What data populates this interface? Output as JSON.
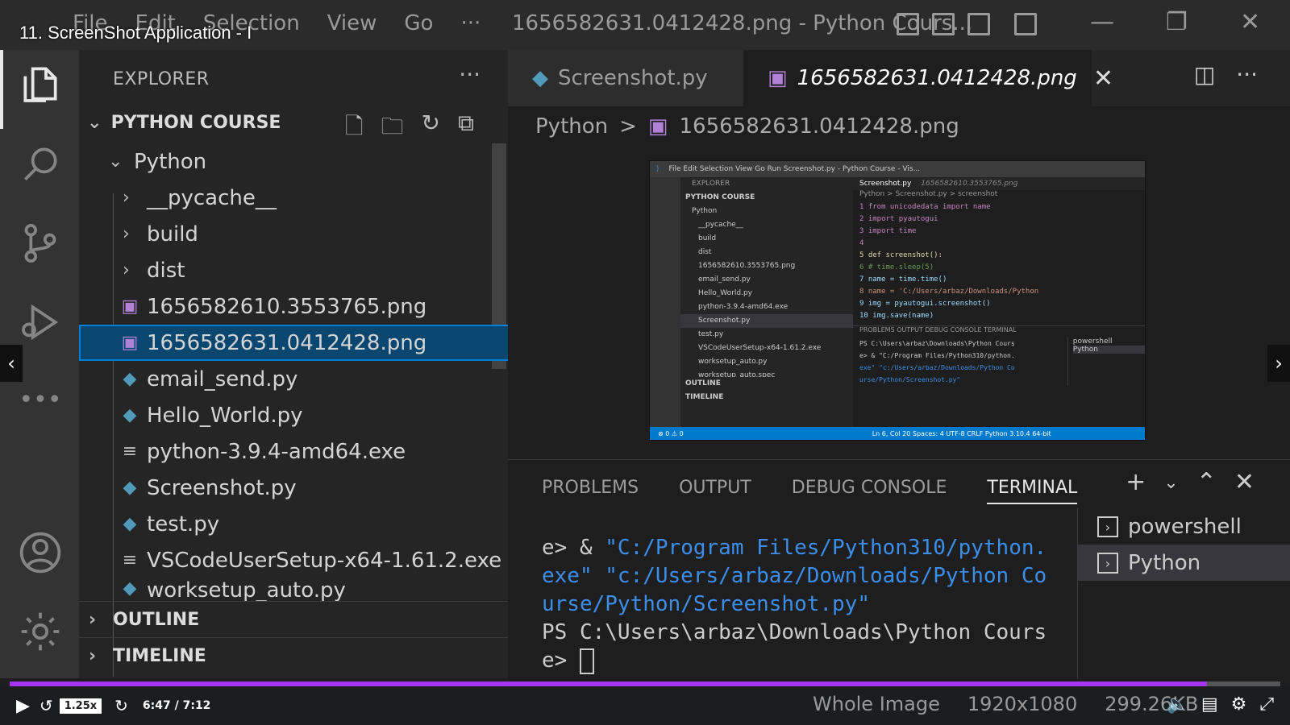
{
  "course_title": "11. ScreenShot Application - I",
  "window": {
    "menu": [
      "File",
      "Edit",
      "Selection",
      "View",
      "Go",
      "···"
    ],
    "title": "1656582631.0412428.png - Python Cours...",
    "controls": {
      "minimize": "—",
      "restore": "❐",
      "close": "✕"
    }
  },
  "sidebar": {
    "header": "EXPLORER",
    "more": "···",
    "section": "PYTHON COURSE",
    "folder": "Python",
    "items": [
      {
        "label": "__pycache__",
        "kind": "folder"
      },
      {
        "label": "build",
        "kind": "folder"
      },
      {
        "label": "dist",
        "kind": "folder"
      },
      {
        "label": "1656582610.3553765.png",
        "kind": "image"
      },
      {
        "label": "1656582631.0412428.png",
        "kind": "image",
        "selected": true
      },
      {
        "label": "email_send.py",
        "kind": "python"
      },
      {
        "label": "Hello_World.py",
        "kind": "python"
      },
      {
        "label": "python-3.9.4-amd64.exe",
        "kind": "exe"
      },
      {
        "label": "Screenshot.py",
        "kind": "python"
      },
      {
        "label": "test.py",
        "kind": "python"
      },
      {
        "label": "VSCodeUserSetup-x64-1.61.2.exe",
        "kind": "exe"
      },
      {
        "label": "worksetup_auto.py",
        "kind": "python"
      }
    ],
    "outline": "OUTLINE",
    "timeline": "TIMELINE"
  },
  "tabs": [
    {
      "label": "Screenshot.py",
      "active": false
    },
    {
      "label": "1656582631.0412428.png",
      "active": true,
      "close": "✕"
    }
  ],
  "breadcrumb": {
    "folder": "Python",
    "sep": ">",
    "file": "1656582631.0412428.png"
  },
  "preview": {
    "menu": "File  Edit  Selection  View  Go  Run   Screenshot.py - Python Course - Vis...",
    "explorer": "EXPLORER",
    "section": "PYTHON COURSE",
    "tree": [
      "Python",
      "__pycache__",
      "build",
      "dist",
      "1656582610.3553765.png",
      "email_send.py",
      "Hello_World.py",
      "python-3.9.4-amd64.exe",
      "Screenshot.py",
      "test.py",
      "VSCodeUserSetup-x64-1.61.2.exe",
      "worksetup_auto.py",
      "worksetup_auto.spec"
    ],
    "outline": "OUTLINE",
    "timeline": "TIMELINE",
    "tab_active": "Screenshot.py",
    "tab_other": "1656582610.3553765.png",
    "crumb": "Python > Screenshot.py > screenshot",
    "code": [
      "1  from unicodedata import name",
      "2  import pyautogui",
      "3  import time",
      "4",
      "5  def screenshot():",
      "6      # time.sleep(5)",
      "7      name = time.time()",
      "8      name = 'C:/Users/arbaz/Downloads/Python",
      "9      img = pyautogui.screenshot()",
      "10     img.save(name)"
    ],
    "panel_tabs": "PROBLEMS   OUTPUT   DEBUG CONSOLE   TERMINAL",
    "terminal": [
      "PS C:\\Users\\arbaz\\Downloads\\Python Cours",
      "e> & \"C:/Program Files/Python310/python.",
      "exe\" \"c:/Users/arbaz/Downloads/Python Co",
      "urse/Python/Screenshot.py\""
    ],
    "term_list": [
      "powershell",
      "Python"
    ],
    "status_left": "⊗ 0 ⚠ 0",
    "status_right": "Ln 6, Col 20   Spaces: 4   UTF-8   CRLF   Python   3.10.4 64-bit"
  },
  "panel": {
    "tabs": [
      "PROBLEMS",
      "OUTPUT",
      "DEBUG CONSOLE",
      "TERMINAL"
    ],
    "active_tab": "TERMINAL",
    "terminal_lines": [
      "e> & ",
      "\"C:/Program Files/Python310/python.",
      "exe\" \"c:/Users/arbaz/Downloads/Python Co",
      "urse/Python/Screenshot.py\"",
      "PS C:\\Users\\arbaz\\Downloads\\Python Cours",
      "e> "
    ],
    "terminals": [
      "powershell",
      "Python"
    ]
  },
  "player": {
    "speed": "1.25x",
    "time": "6:47 / 7:12",
    "progress": 0.942,
    "info": [
      "Whole Image",
      "1920x1080",
      "299.26KB"
    ]
  },
  "colors": {
    "accent": "#007acc",
    "selection": "#094771",
    "progress": "#a435f0"
  }
}
